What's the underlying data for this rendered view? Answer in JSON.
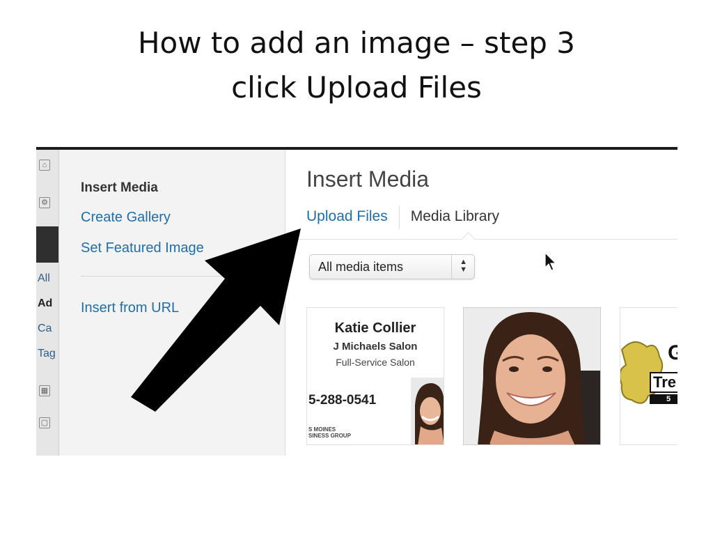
{
  "slide": {
    "title_line1": "How to add an image – step 3",
    "title_line2": "click Upload Files"
  },
  "wp_edge": {
    "labels": [
      "All",
      "Ad",
      "Ca",
      "Tag"
    ]
  },
  "media_menu": {
    "items": [
      {
        "label": "Insert Media",
        "active": true
      },
      {
        "label": "Create Gallery",
        "active": false
      },
      {
        "label": "Set Featured Image",
        "active": false
      },
      {
        "label": "Insert from URL",
        "active": false
      }
    ]
  },
  "media_frame": {
    "title": "Insert Media",
    "tabs": {
      "upload": "Upload Files",
      "library": "Media Library"
    },
    "filter": {
      "selected": "All media items"
    }
  },
  "attachments": {
    "card": {
      "name": "Katie Collier",
      "salon": "J Michaels Salon",
      "service": "Full-Service Salon",
      "phone": "5-288-0541",
      "group": "S MOINES\nSINESS GROUP"
    },
    "logo": {
      "letter": "G",
      "word": "Tre",
      "bar": "5"
    }
  },
  "colors": {
    "link_blue": "#1f6ea8",
    "arrow": "#000000"
  },
  "icons": [
    "cursor-icon",
    "select-arrows-icon",
    "pointer-arrow-icon"
  ]
}
